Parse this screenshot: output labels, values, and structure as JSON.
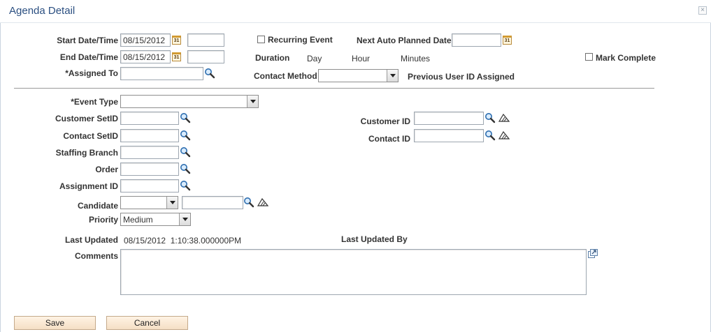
{
  "window": {
    "title": "Agenda Detail",
    "close_glyph": "×"
  },
  "labels": {
    "start_datetime": "Start Date/Time",
    "end_datetime": "End Date/Time",
    "assigned_to": "*Assigned To",
    "recurring_event": "Recurring Event",
    "next_auto_planned_date": "Next Auto Planned Date",
    "duration": "Duration",
    "day": "Day",
    "hour": "Hour",
    "minutes": "Minutes",
    "mark_complete": "Mark Complete",
    "contact_method": "Contact Method",
    "previous_user_id_assigned": "Previous User ID Assigned",
    "event_type": "*Event Type",
    "customer_setid": "Customer SetID",
    "contact_setid": "Contact SetID",
    "staffing_branch": "Staffing Branch",
    "order": "Order",
    "assignment_id": "Assignment ID",
    "candidate": "Candidate",
    "priority": "Priority",
    "customer_id": "Customer ID",
    "contact_id": "Contact ID",
    "last_updated": "Last Updated",
    "last_updated_by": "Last Updated By",
    "comments": "Comments"
  },
  "values": {
    "start_date": "08/15/2012",
    "start_time": "",
    "end_date": "08/15/2012",
    "end_time": "",
    "assigned_to": "",
    "next_auto_planned_date": "",
    "contact_method": "",
    "event_type": "",
    "customer_setid": "",
    "contact_setid": "",
    "staffing_branch": "",
    "order": "",
    "assignment_id": "",
    "candidate_type": "",
    "candidate_id": "",
    "priority": "Medium",
    "customer_id": "",
    "contact_id": "",
    "last_updated": "08/15/2012  1:10:38.000000PM",
    "last_updated_by": "",
    "comments": "",
    "recurring_event_checked": false,
    "mark_complete_checked": false
  },
  "calendar_icon_text": "31",
  "buttons": {
    "save": "Save",
    "cancel": "Cancel"
  },
  "colors": {
    "title": "#2b4f81",
    "button_bg": "#f5dfc5",
    "lookup_icon": "#2f6fb0"
  }
}
